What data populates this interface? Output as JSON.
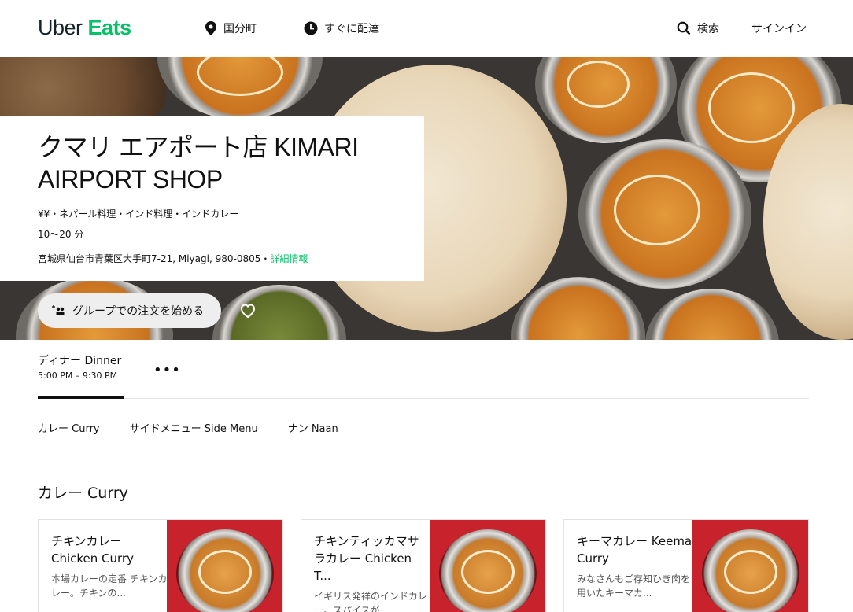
{
  "header": {
    "logo_part1": "Uber",
    "logo_part2": "Eats",
    "location": "国分町",
    "delivery": "すぐに配達",
    "search": "検索",
    "signin": "サインイン"
  },
  "restaurant": {
    "title": "クマリ エアポート店 KIMARI AIRPORT SHOP",
    "cuisine": "¥¥・ネパール料理・インド料理・インドカレー",
    "time": "10〜20 分",
    "address": "宮城県仙台市青葉区大手町7-21, Miyagi, 980-0805・",
    "details_link": "詳細情報",
    "group_order_label": "グループでの注文を始める"
  },
  "menu": {
    "name": "ディナー Dinner",
    "hours": "5:00 PM – 9:30 PM",
    "more": "•••",
    "categories": [
      "カレー Curry",
      "サイドメニュー Side Menu",
      "ナン Naan"
    ]
  },
  "section": {
    "title": "カレー Curry",
    "items": [
      {
        "name": "チキンカレー Chicken Curry",
        "desc": "本場カレーの定番 チキンカレー。チキンの..."
      },
      {
        "name": "チキンティッカマサラカレー Chicken T...",
        "desc": "イギリス発祥のインドカレー。スパイスが..."
      },
      {
        "name": "キーマカレー Keema Curry",
        "desc": "みなさんもご存知ひき肉を用いたキーマカ..."
      }
    ]
  },
  "colors": {
    "brand_green": "#06c167",
    "text": "#111111",
    "card_image_bg": "#c8222c"
  }
}
